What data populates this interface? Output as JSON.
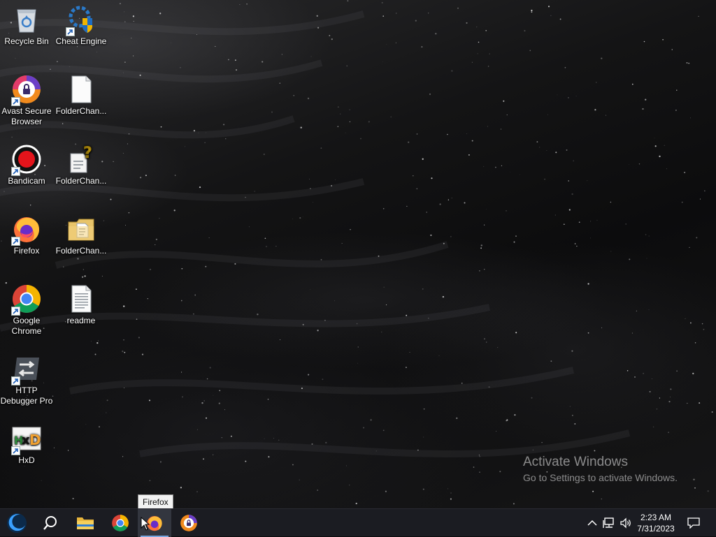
{
  "desktop": {
    "icons": [
      {
        "label": "Recycle Bin",
        "icon": "recycle-bin-icon",
        "shortcut": false
      },
      {
        "label": "Cheat Engine",
        "icon": "cheat-engine-icon",
        "shortcut": true
      },
      {
        "label": "Avast Secure Browser",
        "icon": "avast-secure-browser-icon",
        "shortcut": true
      },
      {
        "label": "FolderChan...",
        "icon": "blank-file-icon",
        "shortcut": false
      },
      {
        "label": "Bandicam",
        "icon": "bandicam-icon",
        "shortcut": true
      },
      {
        "label": "FolderChan...",
        "icon": "unknown-file-icon",
        "shortcut": false
      },
      {
        "label": "Firefox",
        "icon": "firefox-icon",
        "shortcut": true
      },
      {
        "label": "FolderChan...",
        "icon": "folder-document-icon",
        "shortcut": false
      },
      {
        "label": "Google Chrome",
        "icon": "chrome-icon",
        "shortcut": true
      },
      {
        "label": "readme",
        "icon": "text-file-icon",
        "shortcut": false
      },
      {
        "label": "HTTP Debugger Pro",
        "icon": "http-debugger-icon",
        "shortcut": true
      },
      {
        "label": "HxD",
        "icon": "hxd-icon",
        "shortcut": true
      }
    ]
  },
  "watermark": {
    "title": "Activate Windows",
    "subtitle": "Go to Settings to activate Windows."
  },
  "tooltip": {
    "text": "Firefox"
  },
  "taskbar": {
    "buttons": [
      {
        "name": "start",
        "icon": "start-orb-icon"
      },
      {
        "name": "search",
        "icon": "search-icon"
      },
      {
        "name": "file-explorer",
        "icon": "folder-icon"
      },
      {
        "name": "chrome",
        "icon": "chrome-icon"
      },
      {
        "name": "firefox",
        "icon": "firefox-icon",
        "state": "hovered"
      },
      {
        "name": "avast-secure-browser",
        "icon": "avast-secure-browser-icon"
      }
    ],
    "tray": {
      "icons": [
        "chevron-up-icon",
        "network-icon",
        "volume-icon"
      ],
      "time": "2:23 AM",
      "date": "7/31/2023",
      "notification_icon": "notification-icon"
    }
  },
  "colors": {
    "taskbar": "#1b1c22",
    "accent": "#7aa7e0"
  }
}
